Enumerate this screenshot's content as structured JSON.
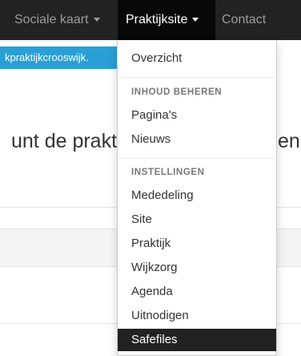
{
  "topnav": {
    "items": [
      {
        "label": "Sociale kaart",
        "has_caret": true
      },
      {
        "label": "Praktijksite",
        "has_caret": true,
        "active": true
      },
      {
        "label": "Contact",
        "has_caret": false
      }
    ]
  },
  "url_fragment": "kpraktijkcrooswijk.",
  "heading": {
    "left_text": "unt de prakti",
    "right_text": "en"
  },
  "dropdown": {
    "overview": "Overzicht",
    "section_content": {
      "header": "INHOUD BEHEREN",
      "items": [
        "Pagina's",
        "Nieuws"
      ]
    },
    "section_settings": {
      "header": "INSTELLINGEN",
      "items": [
        "Mededeling",
        "Site",
        "Praktijk",
        "Wijkzorg",
        "Agenda",
        "Uitnodigen",
        "Safefiles"
      ]
    },
    "active_item": "Safefiles"
  },
  "colors": {
    "navbar_bg": "#222222",
    "link_blue": "#2a9fd6",
    "active_item_bg": "#222222"
  }
}
